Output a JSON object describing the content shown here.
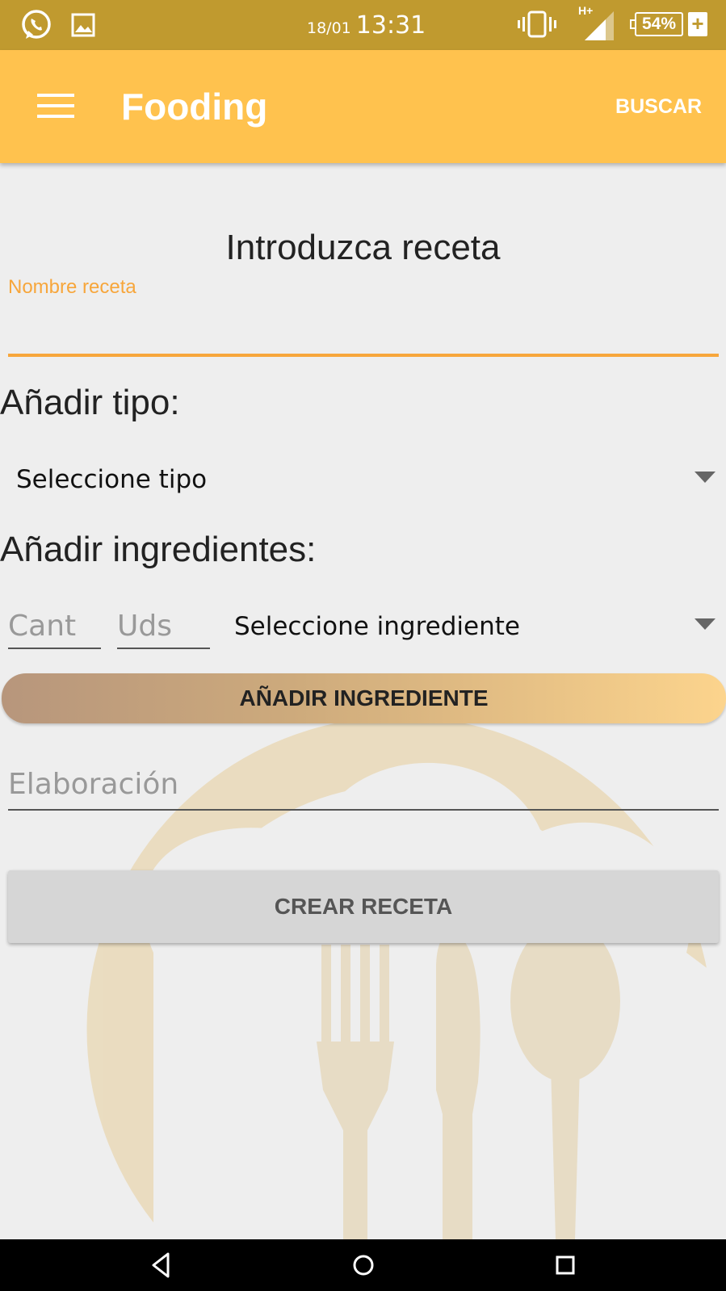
{
  "status_bar": {
    "date": "18/01",
    "time": "13:31",
    "network": "H+",
    "battery": "54%",
    "battery_charging": "+",
    "icons": [
      "whatsapp-icon",
      "image-icon",
      "vibrate-icon",
      "signal-icon",
      "battery-icon"
    ]
  },
  "app_bar": {
    "title": "Fooding",
    "action": "BUSCAR",
    "background": "#ffc24e"
  },
  "form": {
    "heading": "Introduzca receta",
    "name_label": "Nombre receta",
    "name_value": "",
    "type_section": "Añadir tipo:",
    "type_spinner": "Seleccione tipo",
    "ingredients_section": "Añadir ingredientes:",
    "qty_placeholder": "Cant",
    "units_placeholder": "Uds",
    "ingredient_spinner": "Seleccione ingrediente",
    "add_ingredient_button": "AÑADIR INGREDIENTE",
    "elaboration_placeholder": "Elaboración",
    "create_button": "CREAR RECETA"
  },
  "colors": {
    "accent": "#f7a63b",
    "status_bar": "#c09a2f"
  }
}
